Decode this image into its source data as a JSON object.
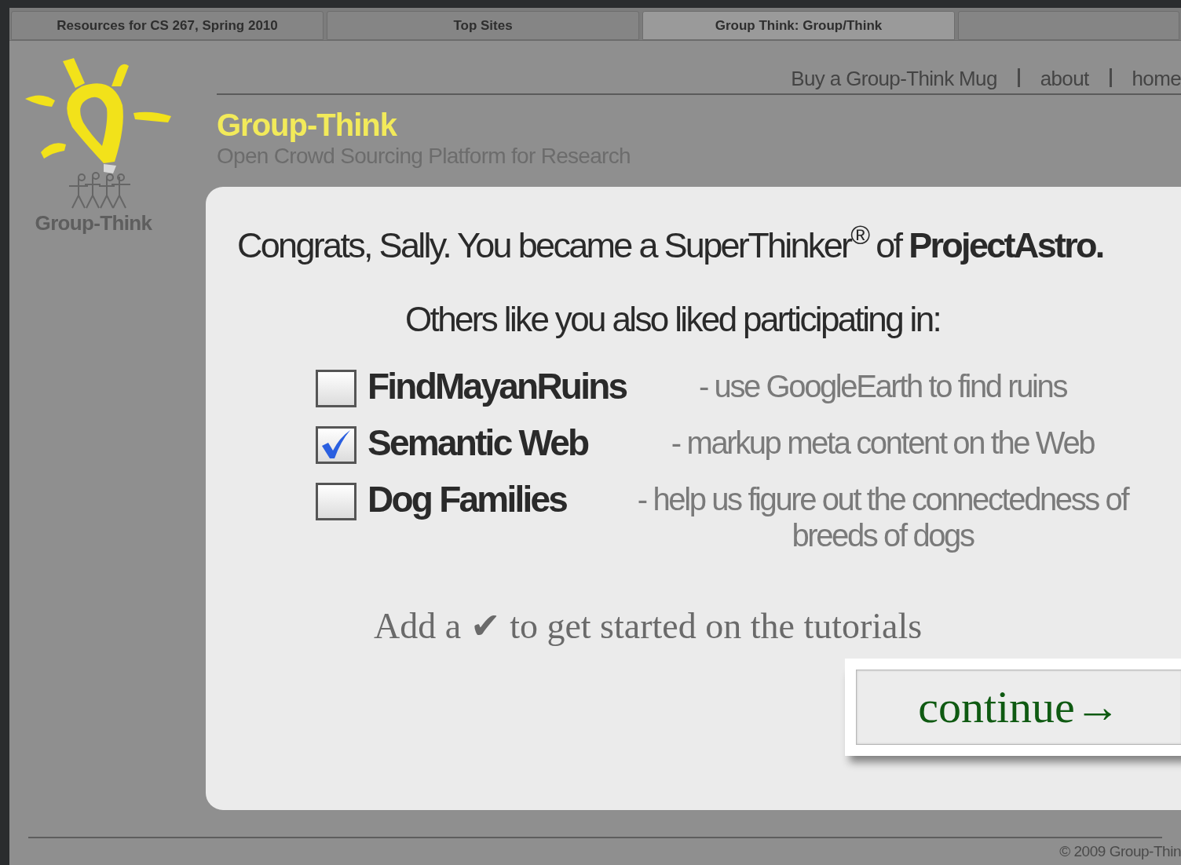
{
  "browser_tabs": [
    {
      "label": "Resources for CS 267, Spring 2010",
      "selected": false
    },
    {
      "label": "Top Sites",
      "selected": false
    },
    {
      "label": "Group Think: Group/Think",
      "selected": true
    },
    {
      "selected": false
    }
  ],
  "logo": {
    "caption": "Group-Think"
  },
  "nav_links": [
    "Buy a Group-Think Mug",
    "about",
    "home"
  ],
  "site": {
    "title": "Group-Think",
    "tagline": "Open Crowd Sourcing Platform for Research"
  },
  "headline": "Congrats, Sally. You became a SuperThinker$^{®}$ of **ProjectAstro.**",
  "subheading": "Others like you also liked participating in:",
  "projects": [
    {
      "name": "FindMayanRuins",
      "description": "- use GoogleEarth to find ruins",
      "checked": false
    },
    {
      "name": "Semantic Web",
      "description": "- markup meta content on the Web",
      "checked": true
    },
    {
      "name": "Dog Families",
      "description": "- help us figure out the connectedness of breeds of dogs",
      "checked": false
    }
  ],
  "hint": "Add a ✔ to get started on the tutorials",
  "continue_button": "continue→",
  "footer": "© 2009 Group-Thin"
}
